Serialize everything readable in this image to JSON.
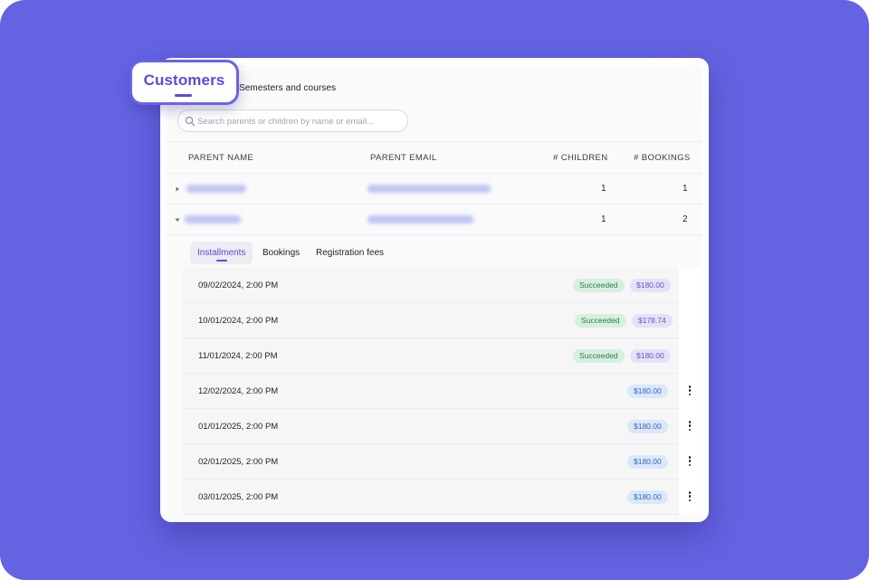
{
  "nav": {
    "active_tab": "Customers",
    "tabs": [
      "Customers",
      "Semesters and courses"
    ]
  },
  "search": {
    "placeholder": "Search parents or children by name or email..."
  },
  "table": {
    "columns": [
      "PARENT NAME",
      "PARENT EMAIL",
      "# CHILDREN",
      "# BOOKINGS"
    ],
    "rows": [
      {
        "children": "1",
        "bookings": "1",
        "expanded": false
      },
      {
        "children": "1",
        "bookings": "2",
        "expanded": true
      }
    ]
  },
  "subtabs": [
    "Installments",
    "Bookings",
    "Registration fees"
  ],
  "installments": [
    {
      "date": "09/02/2024, 2:00 PM",
      "status": "Succeeded",
      "amount": "$180.00",
      "has_menu": false
    },
    {
      "date": "10/01/2024, 2:00 PM",
      "status": "Succeeded",
      "amount": "$178.74",
      "has_menu": false
    },
    {
      "date": "11/01/2024, 2:00 PM",
      "status": "Succeeded",
      "amount": "$180.00",
      "has_menu": false
    },
    {
      "date": "12/02/2024, 2:00 PM",
      "status": "",
      "amount": "$180.00",
      "has_menu": true
    },
    {
      "date": "01/01/2025, 2:00 PM",
      "status": "",
      "amount": "$180.00",
      "has_menu": true
    },
    {
      "date": "02/01/2025, 2:00 PM",
      "status": "",
      "amount": "$180.00",
      "has_menu": true
    },
    {
      "date": "03/01/2025, 2:00 PM",
      "status": "",
      "amount": "$180.00",
      "has_menu": true
    }
  ],
  "colors": {
    "background": "#6463e2",
    "accent": "#5b4bd8",
    "success_bg": "#d6efdf",
    "success_text": "#2f7d4c",
    "paid_amount_bg": "#e7e1f8",
    "upcoming_amount_bg": "#d9e8fb"
  },
  "icons": {
    "search": "search-icon",
    "collapsed": "caret-right-icon",
    "expanded": "caret-down-icon",
    "row_menu": "kebab-menu-icon"
  }
}
